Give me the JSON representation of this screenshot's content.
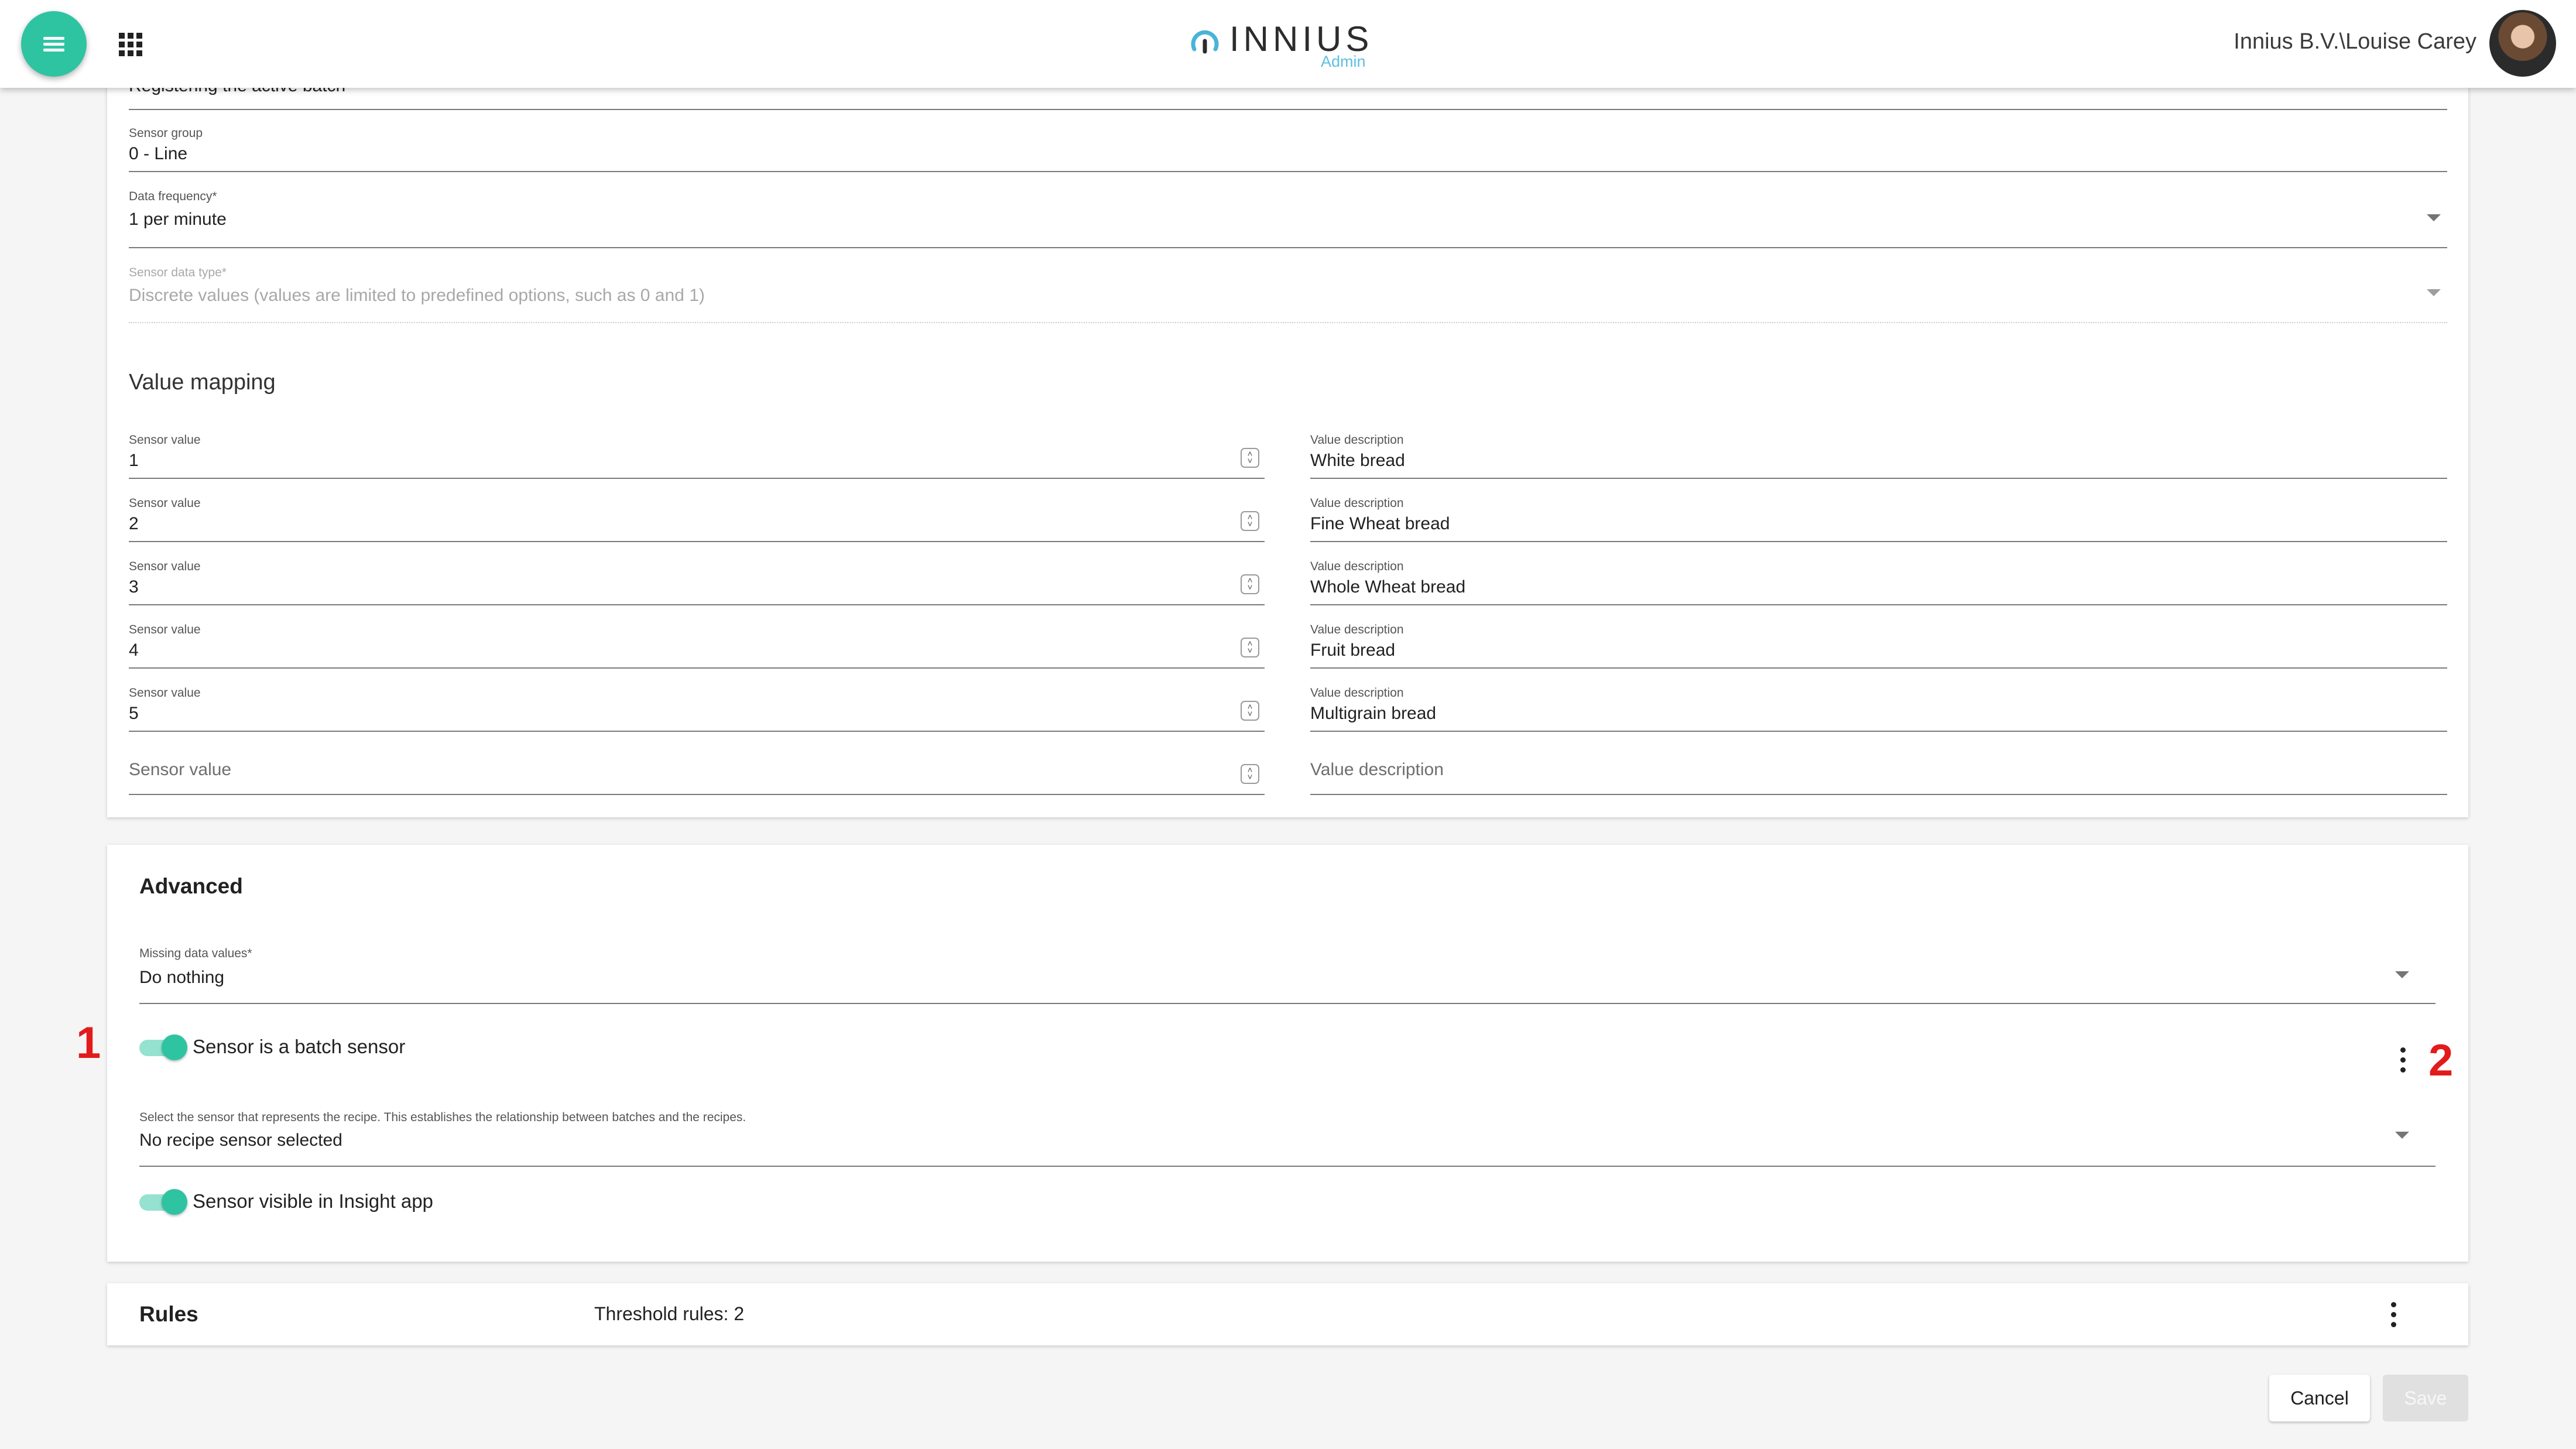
{
  "header": {
    "logo_text": "INNIUS",
    "logo_sub": "Admin",
    "user_label": "Innius B.V.\\Louise Carey"
  },
  "form": {
    "top_partial_value": "Registering the active batch",
    "sensor_group": {
      "label": "Sensor group",
      "value": "0 - Line"
    },
    "data_frequency": {
      "label": "Data frequency*",
      "value": "1 per minute"
    },
    "sensor_data_type": {
      "label": "Sensor data type*",
      "value": "Discrete values (values are limited to predefined options, such as 0 and 1)"
    }
  },
  "value_mapping": {
    "title": "Value mapping",
    "sensor_value_label": "Sensor value",
    "value_description_label": "Value description",
    "rows": [
      {
        "sensor_value": "1",
        "description": "White bread"
      },
      {
        "sensor_value": "2",
        "description": "Fine Wheat bread"
      },
      {
        "sensor_value": "3",
        "description": "Whole Wheat bread"
      },
      {
        "sensor_value": "4",
        "description": "Fruit bread"
      },
      {
        "sensor_value": "5",
        "description": "Multigrain bread"
      }
    ],
    "empty_sensor_placeholder": "Sensor value",
    "empty_description_placeholder": "Value description"
  },
  "advanced": {
    "title": "Advanced",
    "missing_data": {
      "label": "Missing data values*",
      "value": "Do nothing"
    },
    "batch_toggle": {
      "label": "Sensor is a batch sensor",
      "on": true
    },
    "recipe_sensor": {
      "label": "Select the sensor that represents the recipe. This establishes the relationship between batches and the recipes.",
      "value": "No recipe sensor selected"
    },
    "insight_toggle": {
      "label": "Sensor visible in Insight app",
      "on": true
    }
  },
  "rules": {
    "title": "Rules",
    "threshold_label": "Threshold rules: 2"
  },
  "actions": {
    "cancel_label": "Cancel",
    "save_label": "Save"
  },
  "annotations": {
    "marker_1": "1",
    "marker_2": "2"
  },
  "colors": {
    "accent": "#2ec4a2",
    "annotation": "#e21b1b",
    "logo_sub": "#5cc0de"
  },
  "icons": [
    "menu-icon",
    "apps-grid-icon",
    "logo-icon",
    "dropdown-arrow-icon",
    "spinner-icon",
    "more-vertical-icon"
  ]
}
